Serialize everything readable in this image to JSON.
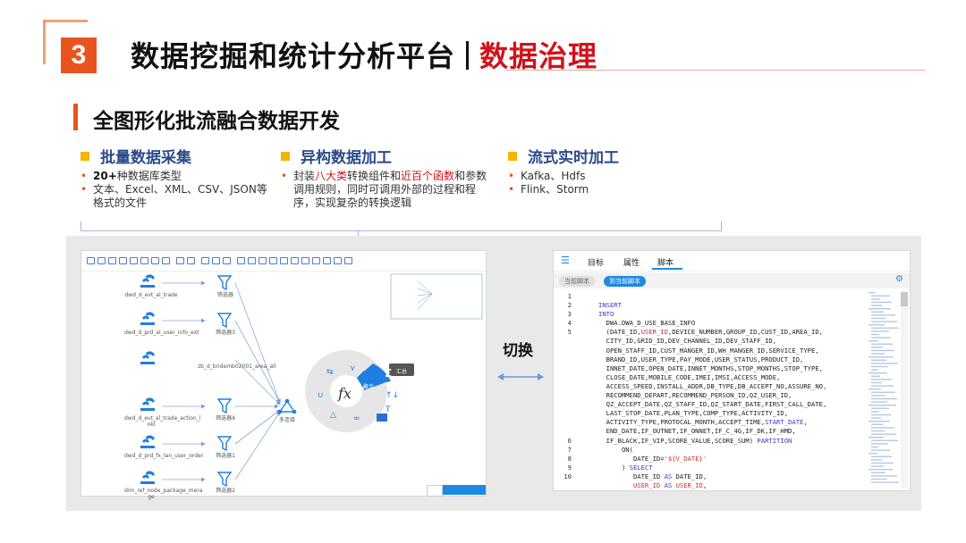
{
  "header": {
    "number": "3",
    "title_main": "数据挖掘和统计分析平台",
    "title_accent": "数据治理"
  },
  "subtitle": "全图形化批流融合数据开发",
  "columns": [
    {
      "heading": "批量数据采集",
      "bullets": [
        {
          "bold": "20+",
          "text": "种数据库类型"
        },
        {
          "text": "文本、Excel、XML、CSV、JSON等格式的文件"
        }
      ]
    },
    {
      "heading": "异构数据加工",
      "bullet": {
        "p1": "封装",
        "red1": "八大类",
        "p2": "转换组件和",
        "red2": "近百个函数",
        "p3": "和参数调用规则，同时可调用外部的过程和程序，实现复杂的转换逻辑"
      }
    },
    {
      "heading": "流式实时加工",
      "bullets": [
        {
          "text": "Kafka、Hdfs"
        },
        {
          "text": "Flink、Storm"
        }
      ]
    }
  ],
  "switch_label": "切换",
  "designer": {
    "sources": [
      {
        "label": "dwd_d_evt_al_trade"
      },
      {
        "label": "dwd_d_prd_al_user_info_ext"
      },
      {
        "label": "zb_d_bridemb02001_area_all"
      },
      {
        "label": "dwd_d_evt_al_trade_action_l nkl"
      },
      {
        "label": "dwd_d_prd_fx_lan_user_order"
      },
      {
        "label": "dim_ref_node_package_mera ge"
      }
    ],
    "filters": [
      "筛选器",
      "筛选器3",
      "",
      "筛选器4",
      "筛选器1",
      "筛选器2"
    ],
    "merge_label": "多连接",
    "radial": {
      "center": "fx",
      "active": "汇总",
      "left_tag": "聚合",
      "tooltip": "汇总"
    }
  },
  "script_window": {
    "tabs": [
      "目标",
      "属性",
      "脚本"
    ],
    "active_tab": "脚本",
    "toggles": [
      "当前脚本",
      "到当前脚本"
    ],
    "active_toggle": "到当前脚本",
    "line_numbers": [
      "1",
      "2",
      "3",
      "4",
      "5",
      "",
      "",
      "",
      "",
      "",
      "",
      "",
      "",
      "",
      "",
      "",
      "6",
      "7",
      "8",
      "9",
      "10"
    ],
    "code": [
      [
        {
          "t": ""
        }
      ],
      [
        {
          "t": "INSERT",
          "c": "kw"
        }
      ],
      [
        {
          "t": "INTO",
          "c": "kw"
        }
      ],
      [
        {
          "t": "  DWA.DWA_D_USE_BASE_INFO"
        }
      ],
      [
        {
          "t": "  (DATE_ID,"
        },
        {
          "t": "USER_ID",
          "c": "hl"
        },
        {
          "t": ",DEVICE_NUMBER,GROUP_ID,CUST_ID,AREA_ID,"
        }
      ],
      [
        {
          "t": "  CITY_ID,GRID_ID,DEV_CHANNEL_ID,DEV_STAFF_ID,"
        }
      ],
      [
        {
          "t": "  OPEN_STAFF_ID,CUST_MANGER_ID,WH_MANGER_ID,SERVICE_TYPE,"
        }
      ],
      [
        {
          "t": "  BRAND_ID,USER_TYPE,PAY_MODE,USER_STATUS,PRODUCT_ID,"
        }
      ],
      [
        {
          "t": "  INNET_DATE,OPEN_DATE,INNET_MONTHS,STOP_MONTHS,STOP_TYPE,"
        }
      ],
      [
        {
          "t": "  CLOSE_DATE,MOBILE_CODE,IMEI,IMSI,ACCESS_MODE,"
        }
      ],
      [
        {
          "t": "  ACCESS_SPEED,INSTALL_ADDR,DB_TYPE,DB_ACCEPT_NO,ASSURE_NO,"
        }
      ],
      [
        {
          "t": "  RECOMMEND_DEPART,RECOMMEND_PERSON_ID,QZ_USER_ID,"
        }
      ],
      [
        {
          "t": "  QZ_ACCEPT_DATE,QZ_STAFF_ID,QZ_START_DATE,FIRST_CALL_DATE,"
        }
      ],
      [
        {
          "t": "  LAST_STOP_DATE,PLAN_TYPE,COMP_TYPE,ACTIVITY_ID,"
        }
      ],
      [
        {
          "t": "  ACTIVITY_TYPE,PROTOCAL_MONTH,ACCEPT_TIME,"
        },
        {
          "t": "START_DATE",
          "c": "kw"
        },
        {
          "t": ","
        }
      ],
      [
        {
          "t": "  END_DATE,IF_OUTNET,IF_ONNET,IF_C_4G,IF_DK,IF_HMD,"
        }
      ],
      [
        {
          "t": "  IF_BLACK,IF_VIP,SCORE_VALUE,SCORE_SUM) "
        },
        {
          "t": "PARTITION",
          "c": "kw"
        }
      ],
      [
        {
          "t": "      ON("
        }
      ],
      [
        {
          "t": "         DATE_ID="
        },
        {
          "t": "'${V_DATE}'",
          "c": "hl"
        }
      ],
      [
        {
          "t": "      ) "
        },
        {
          "t": "SELECT",
          "c": "kw"
        }
      ],
      [
        {
          "t": "         DATE_ID "
        },
        {
          "t": "AS",
          "c": "kw"
        },
        {
          "t": " DATE_ID,"
        }
      ],
      [
        {
          "t": "         "
        },
        {
          "t": "USER_ID",
          "c": "hl"
        },
        {
          "t": " "
        },
        {
          "t": "AS",
          "c": "kw"
        },
        {
          "t": " "
        },
        {
          "t": "USER_ID",
          "c": "hl"
        },
        {
          "t": ","
        }
      ]
    ]
  },
  "colors": {
    "accent": "#e8541f",
    "title_red": "#d0121b",
    "heading_blue": "#2a4a8a",
    "ui_blue": "#1e88e5"
  }
}
